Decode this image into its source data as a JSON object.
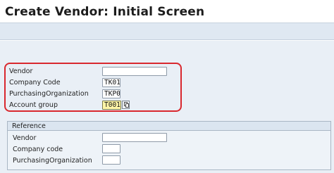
{
  "window": {
    "title": "Create Vendor:  Initial Screen"
  },
  "main": {
    "vendor": {
      "label": "Vendor",
      "value": ""
    },
    "company_code": {
      "label": "Company Code",
      "value": "TK01"
    },
    "purch_org": {
      "label": "PurchasingOrganization",
      "value": "TKP0"
    },
    "account_group": {
      "label": "Account group",
      "value": "T001"
    }
  },
  "reference": {
    "title": "Reference",
    "vendor": {
      "label": "Vendor",
      "value": ""
    },
    "company_code": {
      "label": "Company code",
      "value": ""
    },
    "purch_org": {
      "label": "PurchasingOrganization",
      "value": ""
    }
  },
  "icons": {
    "value_help": "value-help-icon"
  },
  "colors": {
    "highlight": "#d9282e",
    "focus_field": "#fff6a8"
  }
}
